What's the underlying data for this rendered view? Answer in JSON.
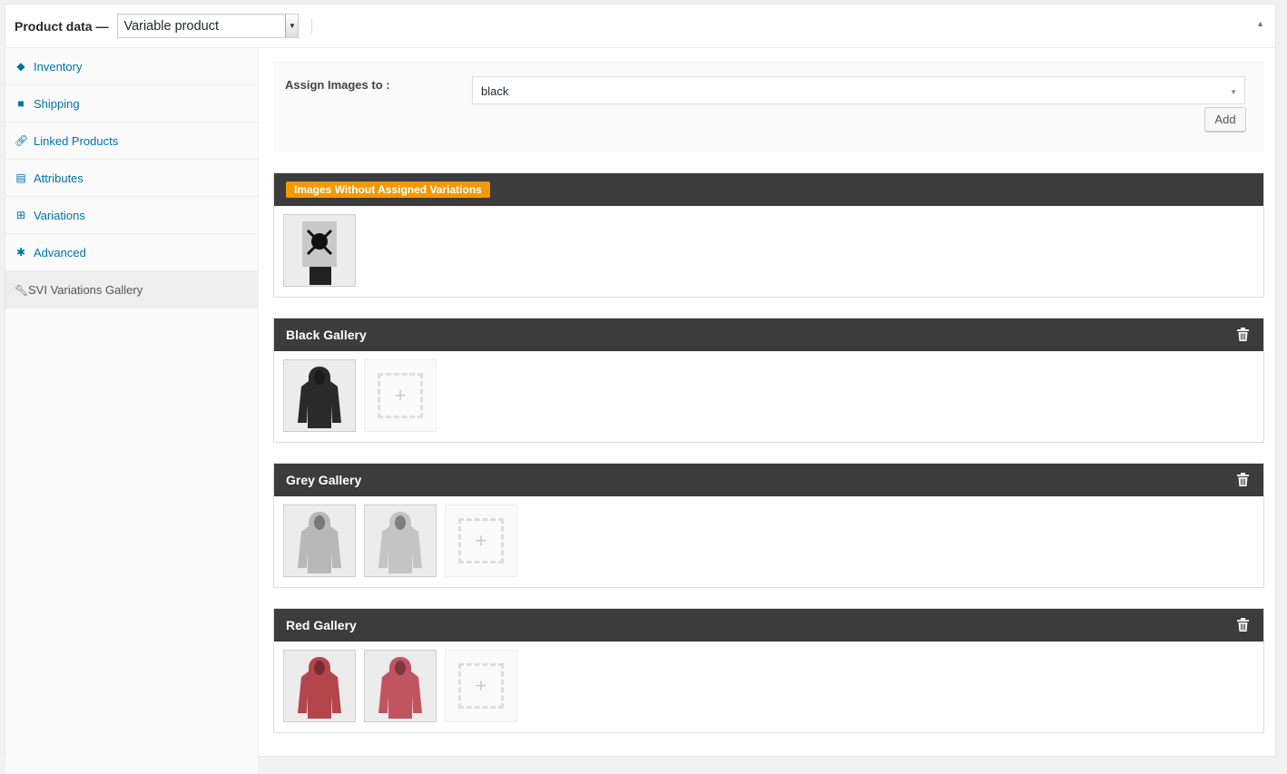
{
  "header": {
    "title": "Product data —",
    "product_type": "Variable product"
  },
  "sidebar": {
    "items": [
      {
        "label": "Inventory",
        "icon": "tag-icon"
      },
      {
        "label": "Shipping",
        "icon": "truck-icon"
      },
      {
        "label": "Linked Products",
        "icon": "link-icon"
      },
      {
        "label": "Attributes",
        "icon": "list-icon"
      },
      {
        "label": "Variations",
        "icon": "grid-icon"
      },
      {
        "label": "Advanced",
        "icon": "gear-icon"
      },
      {
        "label": "SVI Variations Gallery",
        "icon": "wrench-icon"
      }
    ]
  },
  "assign": {
    "label": "Assign Images to :",
    "selected": "black",
    "add_label": "Add"
  },
  "galleries": [
    {
      "title": "Images Without Assigned Variations",
      "images": [
        {
          "alt": "skull poster",
          "color": "#ddd"
        }
      ]
    },
    {
      "title": "Black Gallery",
      "images": [
        {
          "alt": "black hoodie",
          "color": "#2a2a2a"
        }
      ]
    },
    {
      "title": "Grey Gallery",
      "images": [
        {
          "alt": "grey hoodie back",
          "color": "#b8b8b8"
        },
        {
          "alt": "grey hoodie front",
          "color": "#c4c4c4"
        }
      ]
    },
    {
      "title": "Red Gallery",
      "images": [
        {
          "alt": "red hoodie back",
          "color": "#b5454d"
        },
        {
          "alt": "red hoodie front",
          "color": "#c05560"
        }
      ]
    }
  ],
  "colors": {
    "accent": "#0073aa",
    "badge": "#f39800",
    "gallery_header": "#3c3c3c"
  }
}
